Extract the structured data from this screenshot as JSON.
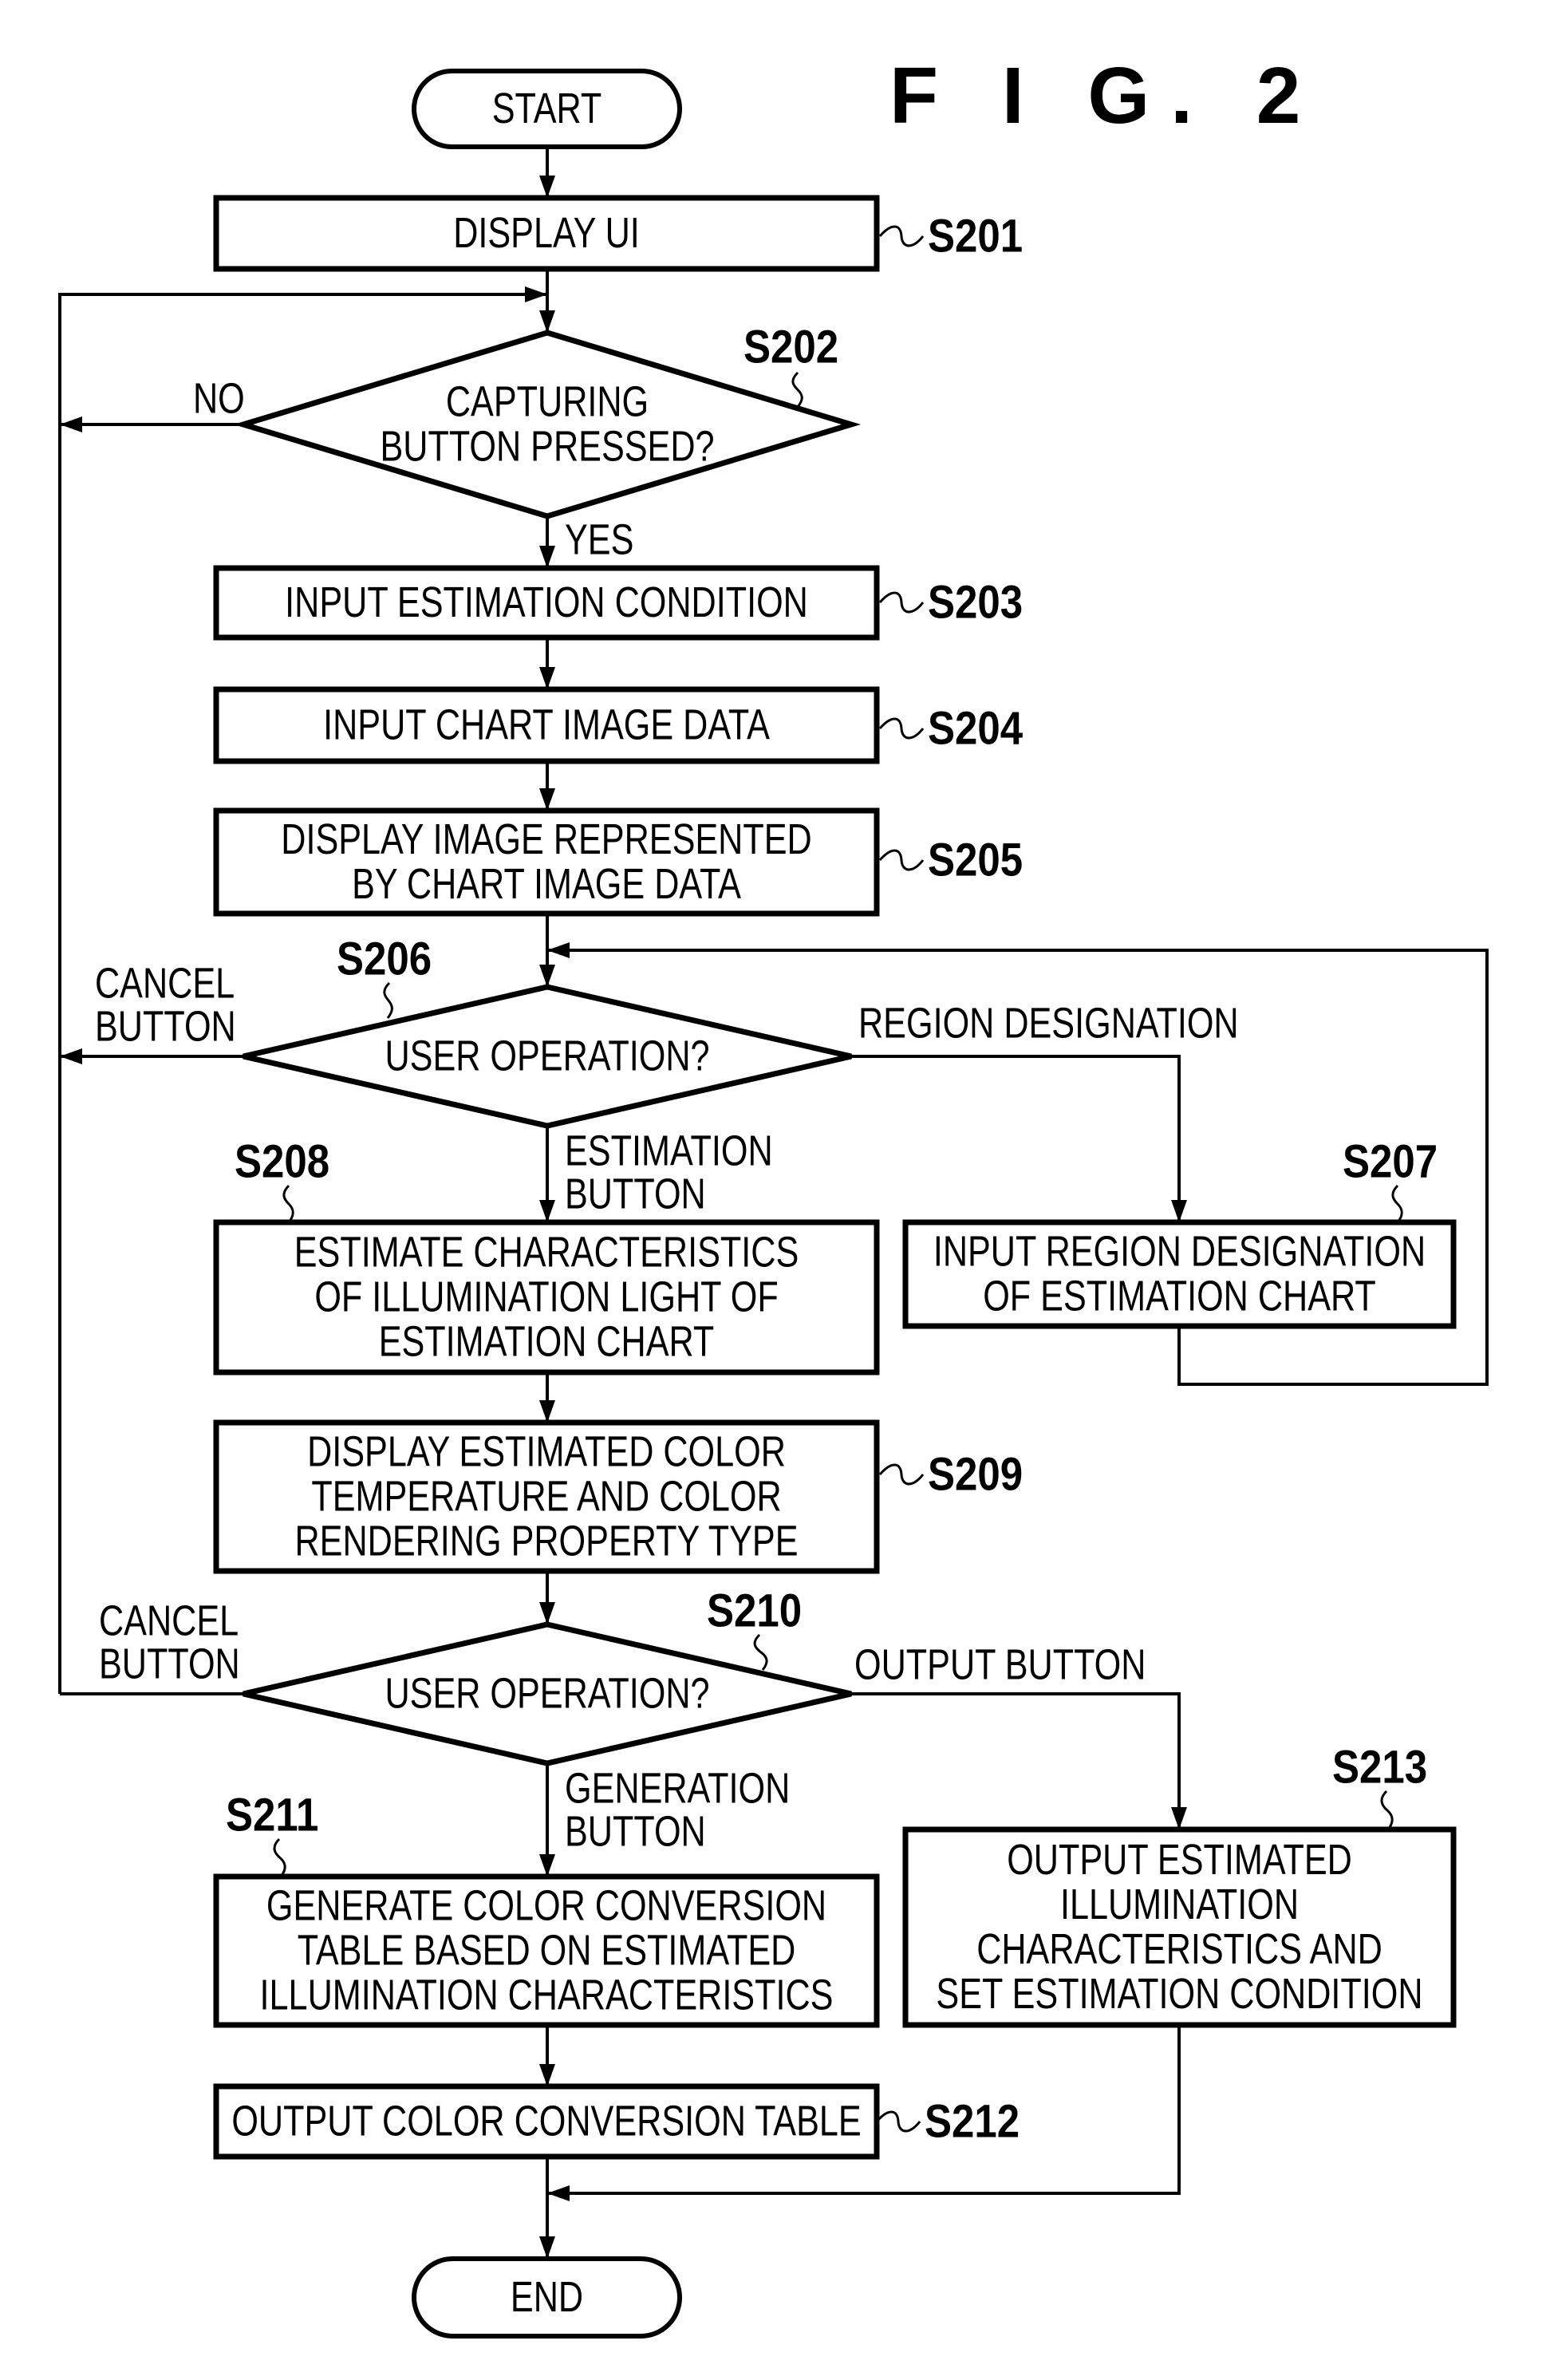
{
  "figure": {
    "title": "F I G. 2"
  },
  "colors": {
    "ink": "#000000",
    "background": "#ffffff"
  },
  "nodes": {
    "start": {
      "type": "terminal",
      "lines": [
        "START"
      ]
    },
    "s201": {
      "type": "process",
      "step": "S201",
      "lines": [
        "DISPLAY UI"
      ]
    },
    "s202": {
      "type": "decision",
      "step": "S202",
      "lines": [
        "CAPTURING",
        "BUTTON PRESSED?"
      ]
    },
    "s203": {
      "type": "process",
      "step": "S203",
      "lines": [
        "INPUT ESTIMATION CONDITION"
      ]
    },
    "s204": {
      "type": "process",
      "step": "S204",
      "lines": [
        "INPUT CHART IMAGE DATA"
      ]
    },
    "s205": {
      "type": "process",
      "step": "S205",
      "lines": [
        "DISPLAY IMAGE REPRESENTED",
        "BY CHART IMAGE DATA"
      ]
    },
    "s206": {
      "type": "decision",
      "step": "S206",
      "lines": [
        "USER OPERATION?"
      ]
    },
    "s207": {
      "type": "process",
      "step": "S207",
      "lines": [
        "INPUT REGION DESIGNATION",
        "OF ESTIMATION CHART"
      ]
    },
    "s208": {
      "type": "process",
      "step": "S208",
      "lines": [
        "ESTIMATE CHARACTERISTICS",
        "OF ILLUMINATION LIGHT OF",
        "ESTIMATION CHART"
      ]
    },
    "s209": {
      "type": "process",
      "step": "S209",
      "lines": [
        "DISPLAY ESTIMATED COLOR",
        "TEMPERATURE AND COLOR",
        "RENDERING PROPERTY TYPE"
      ]
    },
    "s210": {
      "type": "decision",
      "step": "S210",
      "lines": [
        "USER OPERATION?"
      ]
    },
    "s211": {
      "type": "process",
      "step": "S211",
      "lines": [
        "GENERATE COLOR CONVERSION",
        "TABLE BASED ON ESTIMATED",
        "ILLUMINATION CHARACTERISTICS"
      ]
    },
    "s212": {
      "type": "process",
      "step": "S212",
      "lines": [
        "OUTPUT COLOR CONVERSION TABLE"
      ]
    },
    "s213": {
      "type": "process",
      "step": "S213",
      "lines": [
        "OUTPUT ESTIMATED",
        "ILLUMINATION",
        "CHARACTERISTICS AND",
        "SET ESTIMATION CONDITION"
      ]
    },
    "end": {
      "type": "terminal",
      "lines": [
        "END"
      ]
    }
  },
  "edge_labels": {
    "s202_no": [
      "NO"
    ],
    "s202_yes": [
      "YES"
    ],
    "s206_cancel": [
      "CANCEL",
      "BUTTON"
    ],
    "s206_region": [
      "REGION DESIGNATION"
    ],
    "s206_estimation": [
      "ESTIMATION",
      "BUTTON"
    ],
    "s210_cancel": [
      "CANCEL",
      "BUTTON"
    ],
    "s210_output": [
      "OUTPUT BUTTON"
    ],
    "s210_generation": [
      "GENERATION",
      "BUTTON"
    ]
  },
  "edges": [
    {
      "from": "start",
      "to": "s201"
    },
    {
      "from": "s201",
      "to": "s202"
    },
    {
      "from": "s202",
      "to": "s203",
      "label": "s202_yes"
    },
    {
      "from": "s202",
      "to": "s202",
      "label": "s202_no"
    },
    {
      "from": "s203",
      "to": "s204"
    },
    {
      "from": "s204",
      "to": "s205"
    },
    {
      "from": "s205",
      "to": "s206"
    },
    {
      "from": "s206",
      "to": "s202",
      "label": "s206_cancel"
    },
    {
      "from": "s206",
      "to": "s207",
      "label": "s206_region"
    },
    {
      "from": "s207",
      "to": "s206"
    },
    {
      "from": "s206",
      "to": "s208",
      "label": "s206_estimation"
    },
    {
      "from": "s208",
      "to": "s209"
    },
    {
      "from": "s209",
      "to": "s210"
    },
    {
      "from": "s210",
      "to": "s202",
      "label": "s210_cancel"
    },
    {
      "from": "s210",
      "to": "s213",
      "label": "s210_output"
    },
    {
      "from": "s210",
      "to": "s211",
      "label": "s210_generation"
    },
    {
      "from": "s211",
      "to": "s212"
    },
    {
      "from": "s212",
      "to": "end"
    },
    {
      "from": "s213",
      "to": "end"
    }
  ]
}
